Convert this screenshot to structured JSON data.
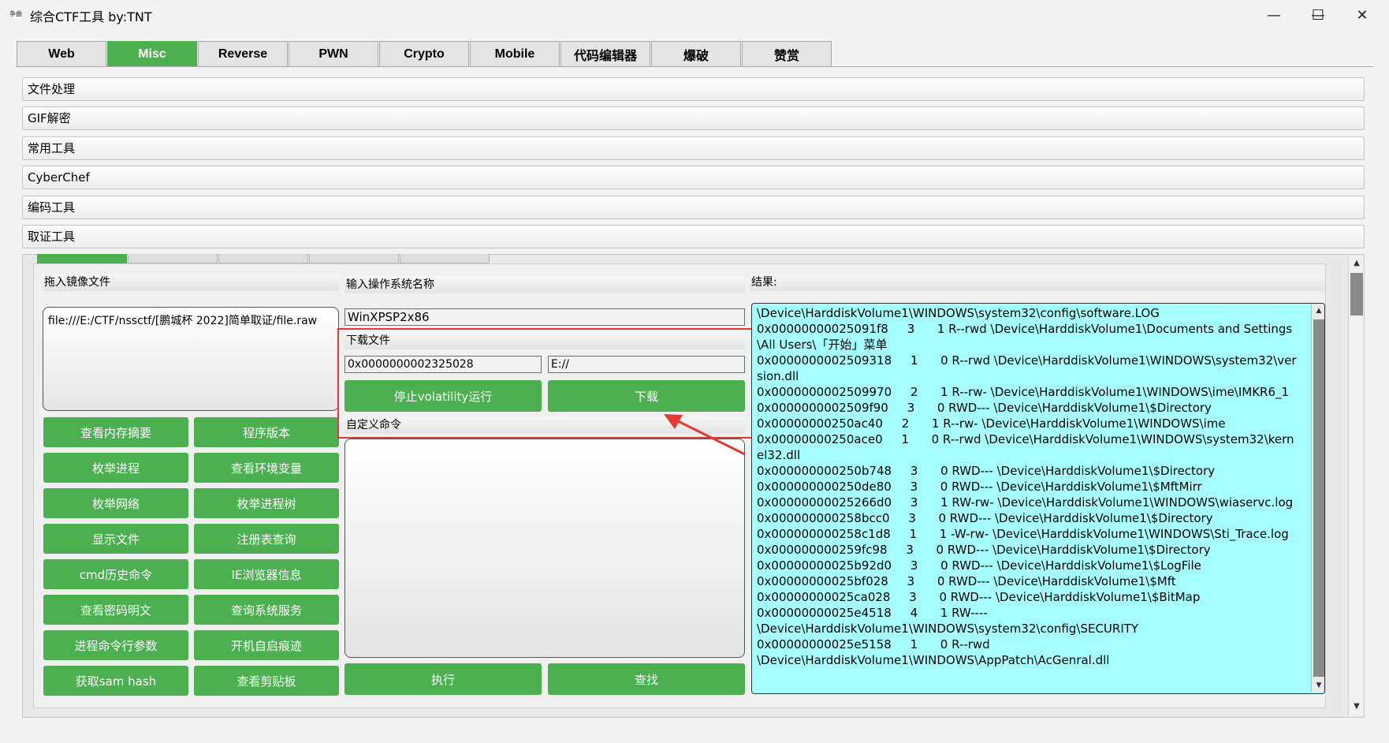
{
  "window": {
    "logo_text": "争曲",
    "title": "综合CTF工具  by:TNT",
    "minimize": "—",
    "maximize": "☐",
    "close": "✕"
  },
  "tabs": [
    "Web",
    "Misc",
    "Reverse",
    "PWN",
    "Crypto",
    "Mobile",
    "代码编辑器",
    "爆破",
    "赞赏"
  ],
  "active_tab": "Misc",
  "accordion": [
    "文件处理",
    "GIF解密",
    "常用工具",
    "CyberChef",
    "编码工具",
    "取证工具"
  ],
  "forensics": {
    "drop_label": "拖入镜像文件",
    "drop_path": "file:///E:/CTF/nssctf/[鹏城杯 2022]简单取证/file.raw",
    "buttons": [
      "查看内存摘要",
      "程序版本",
      "枚举进程",
      "查看环境变量",
      "枚举网络",
      "枚举进程树",
      "显示文件",
      "注册表查询",
      "cmd历史命令",
      "IE浏览器信息",
      "查看密码明文",
      "查询系统服务",
      "进程命令行参数",
      "开机自启痕迹",
      "获取sam hash",
      "查看剪贴板"
    ],
    "os_label": "输入操作系统名称",
    "os_value": "WinXPSP2x86",
    "download_label": "下载文件",
    "offset_value": "0x0000000002325028",
    "dest_value": "E://",
    "stop_button": "停止volatility运行",
    "download_button": "下载",
    "custom_cmd_label": "自定义命令",
    "execute_button": "执行",
    "find_button": "查找",
    "result_label": "结果:",
    "result_text": "\\Device\\HarddiskVolume1\\WINDOWS\\system32\\config\\software.LOG\n0x00000000025091f8     3      1 R--rwd \\Device\\HarddiskVolume1\\Documents and Settings\\All Users\\「开始」菜单\n0x0000000002509318     1      0 R--rwd \\Device\\HarddiskVolume1\\WINDOWS\\system32\\version.dll\n0x0000000002509970     2      1 R--rw- \\Device\\HarddiskVolume1\\WINDOWS\\ime\\IMKR6_1\n0x0000000002509f90     3      0 RWD--- \\Device\\HarddiskVolume1\\$Directory\n0x00000000250ac40     2      1 R--rw- \\Device\\HarddiskVolume1\\WINDOWS\\ime\n0x00000000250ace0     1      0 R--rwd \\Device\\HarddiskVolume1\\WINDOWS\\system32\\kernel32.dll\n0x000000000250b748     3      0 RWD--- \\Device\\HarddiskVolume1\\$Directory\n0x000000000250de80     3      0 RWD--- \\Device\\HarddiskVolume1\\$MftMirr\n0x00000000025266d0     3      1 RW-rw- \\Device\\HarddiskVolume1\\WINDOWS\\wiaservc.log\n0x000000000258bcc0     3      0 RWD--- \\Device\\HarddiskVolume1\\$Directory\n0x000000000258c1d8     1      1 -W-rw- \\Device\\HarddiskVolume1\\WINDOWS\\Sti_Trace.log\n0x000000000259fc98     3      0 RWD--- \\Device\\HarddiskVolume1\\$Directory\n0x00000000025b92d0     3      0 RWD--- \\Device\\HarddiskVolume1\\$LogFile\n0x00000000025bf028     3      0 RWD--- \\Device\\HarddiskVolume1\\$Mft\n0x00000000025ca028     3      0 RWD--- \\Device\\HarddiskVolume1\\$BitMap\n0x00000000025e4518     4      1 RW----\n\\Device\\HarddiskVolume1\\WINDOWS\\system32\\config\\SECURITY\n0x00000000025e5158     1      0 R--rwd\n\\Device\\HarddiskVolume1\\WINDOWS\\AppPatch\\AcGenral.dll"
  },
  "scroll_arrows": {
    "up": "▲",
    "down": "▼"
  },
  "colors": {
    "accent": "#4caf50",
    "result_bg": "#a6fffe",
    "highlight": "#e53935"
  }
}
